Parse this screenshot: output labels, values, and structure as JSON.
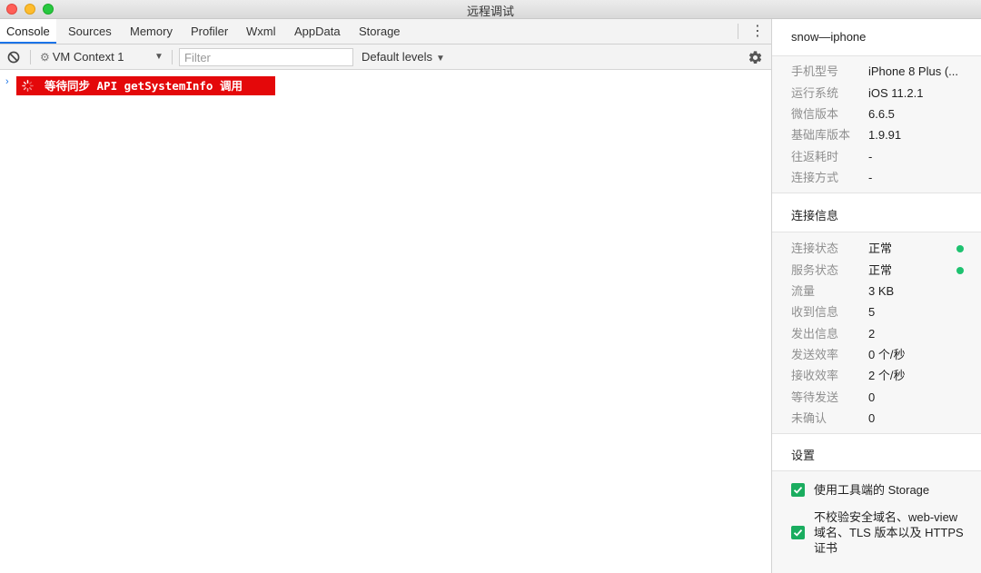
{
  "window": {
    "title": "远程调试"
  },
  "tabs": [
    {
      "label": "Console",
      "active": true
    },
    {
      "label": "Sources"
    },
    {
      "label": "Memory"
    },
    {
      "label": "Profiler"
    },
    {
      "label": "Wxml"
    },
    {
      "label": "AppData"
    },
    {
      "label": "Storage"
    }
  ],
  "toolbar": {
    "context": "VM Context 1",
    "filter_placeholder": "Filter",
    "levels": "Default levels"
  },
  "console": {
    "message": "等待同步 API getSystemInfo 调用",
    "message_bg": "#e4080a"
  },
  "device": {
    "name": "snow—iphone",
    "rows": [
      {
        "k": "手机型号",
        "v": "iPhone 8 Plus (..."
      },
      {
        "k": "运行系统",
        "v": "iOS 11.2.1"
      },
      {
        "k": "微信版本",
        "v": "6.6.5"
      },
      {
        "k": "基础库版本",
        "v": "1.9.91"
      },
      {
        "k": "往返耗时",
        "v": "-"
      },
      {
        "k": "连接方式",
        "v": "-"
      }
    ]
  },
  "connection": {
    "title": "连接信息",
    "status_color": "#1ec270",
    "rows": [
      {
        "k": "连接状态",
        "v": "正常"
      },
      {
        "k": "服务状态",
        "v": "正常"
      },
      {
        "k": "流量",
        "v": "3 KB"
      },
      {
        "k": "收到信息",
        "v": "5"
      },
      {
        "k": "发出信息",
        "v": "2"
      },
      {
        "k": "发送效率",
        "v": "0 个/秒"
      },
      {
        "k": "接收效率",
        "v": "2 个/秒"
      },
      {
        "k": "等待发送",
        "v": "0"
      },
      {
        "k": "未确认",
        "v": "0"
      }
    ]
  },
  "settings": {
    "title": "设置",
    "options": [
      {
        "label": "使用工具端的 Storage",
        "checked": true
      },
      {
        "label": "不校验安全域名、web-view 域名、TLS 版本以及 HTTPS 证书",
        "checked": true
      }
    ]
  }
}
